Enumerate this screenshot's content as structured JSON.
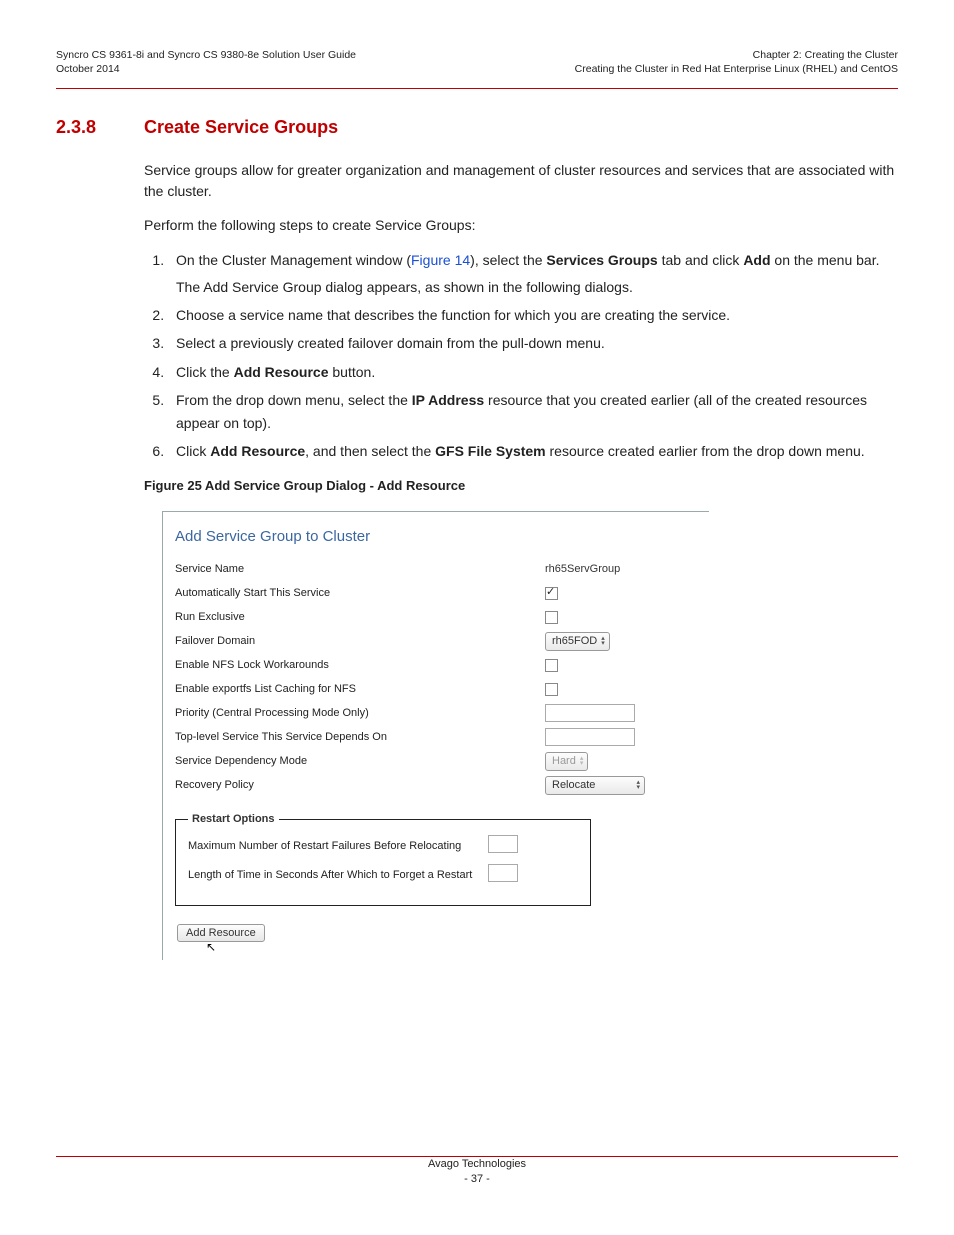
{
  "header": {
    "left_line1": "Syncro CS 9361-8i and Syncro CS 9380-8e Solution User Guide",
    "left_line2": "October 2014",
    "right_line1": "Chapter 2: Creating the Cluster",
    "right_line2": "Creating the Cluster in Red Hat Enterprise Linux (RHEL) and CentOS"
  },
  "section": {
    "number": "2.3.8",
    "title": "Create Service Groups"
  },
  "intro_para": "Service groups allow for greater organization and management of cluster resources and services that are associated with the cluster.",
  "lead_para": "Perform the following steps to create Service Groups:",
  "step1": {
    "pre": "On the Cluster Management window (",
    "xref": "Figure 14",
    "mid": "), select the ",
    "bold1": "Services Groups",
    "mid2": " tab and click ",
    "bold2": "Add",
    "post": " on the menu bar.",
    "sub": "The Add Service Group dialog appears, as shown in the following dialogs."
  },
  "step2": "Choose a service name that describes the function for which you are creating the service.",
  "step3": "Select a previously created failover domain from the pull-down menu.",
  "step4": {
    "pre": "Click the ",
    "bold": "Add Resource",
    "post": " button."
  },
  "step5": {
    "pre": "From the drop down menu, select the ",
    "bold": "IP Address",
    "post": " resource that you created earlier (all of the created resources appear on top)."
  },
  "step6": {
    "pre": "Click ",
    "bold1": "Add Resource",
    "mid": ", and then select the ",
    "bold2": "GFS File System",
    "post": " resource created earlier from the drop down menu."
  },
  "figure_caption": "Figure 25  Add Service Group Dialog - Add Resource",
  "dialog": {
    "title": "Add Service Group to Cluster",
    "service_name_label": "Service Name",
    "service_name_value": "rh65ServGroup",
    "auto_start_label": "Automatically Start This Service",
    "auto_start_checked": true,
    "run_exclusive_label": "Run Exclusive",
    "run_exclusive_checked": false,
    "failover_domain_label": "Failover Domain",
    "failover_domain_value": "rh65FOD",
    "enable_nfs_label": "Enable NFS Lock Workarounds",
    "enable_nfs_checked": false,
    "enable_exportfs_label": "Enable exportfs List Caching for NFS",
    "enable_exportfs_checked": false,
    "priority_label": "Priority (Central Processing Mode Only)",
    "depends_label": "Top-level Service This Service Depends On",
    "dep_mode_label": "Service Dependency Mode",
    "dep_mode_value": "Hard",
    "recovery_label": "Recovery Policy",
    "recovery_value": "Relocate",
    "restart_legend": "Restart Options",
    "restart_max_label": "Maximum Number of Restart Failures Before Relocating",
    "restart_forget_label": "Length of Time in Seconds After Which to Forget a Restart",
    "add_resource_btn": "Add Resource"
  },
  "footer": {
    "company": "Avago Technologies",
    "page": "- 37 -"
  }
}
